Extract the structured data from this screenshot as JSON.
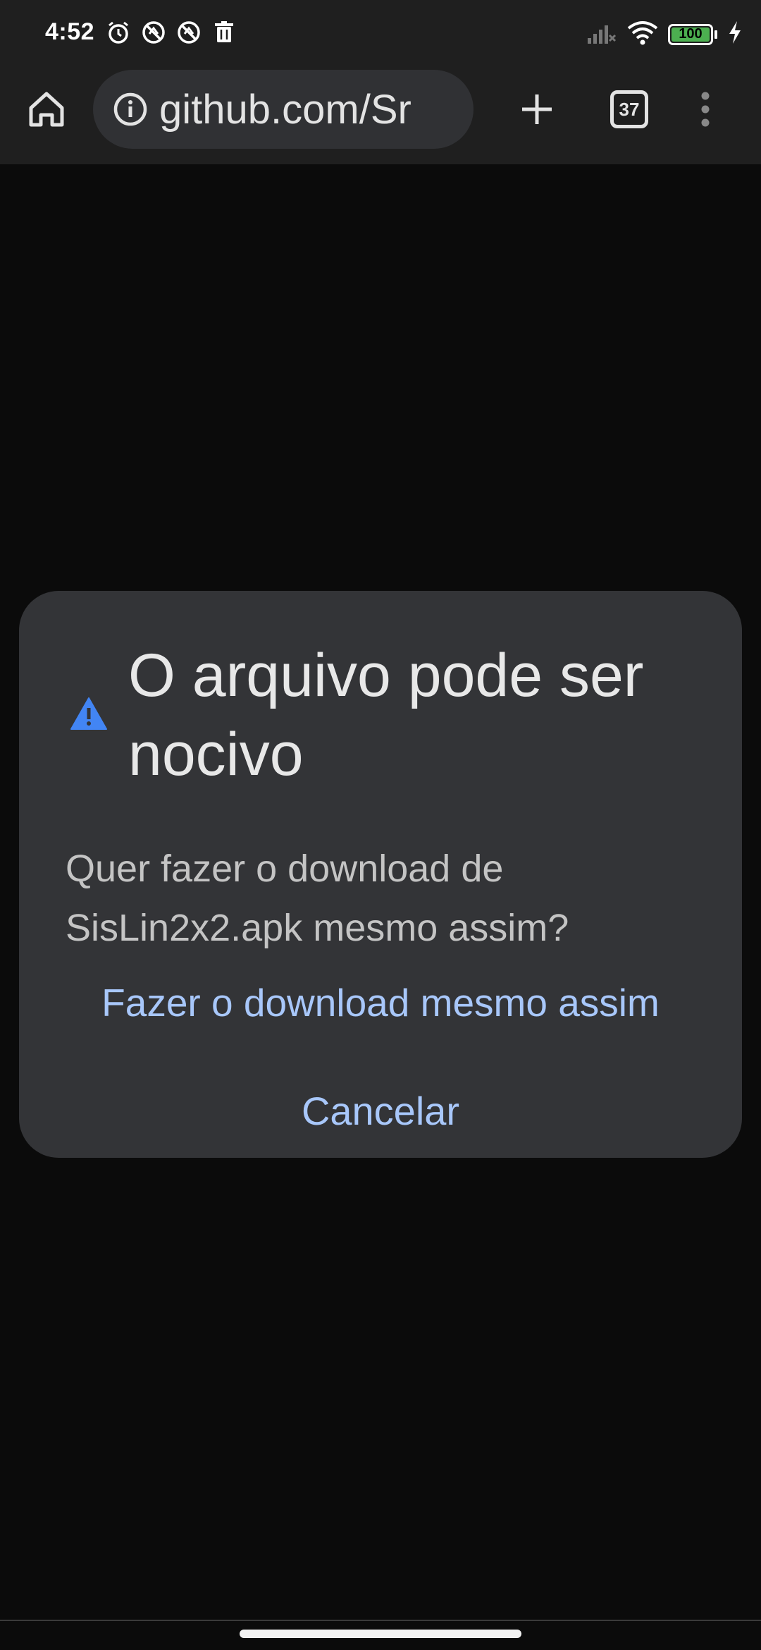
{
  "status_bar": {
    "time": "4:52",
    "notification_icons": [
      "alarm-icon",
      "no-disturb-icon",
      "no-disturb-icon",
      "trash-icon"
    ],
    "battery_level": "100",
    "system_icons": [
      "signal-icon",
      "wifi-icon",
      "battery-icon",
      "charging-icon"
    ]
  },
  "toolbar": {
    "url": "github.com/Sr",
    "tab_count": "37",
    "icons": [
      "home-icon",
      "info-icon",
      "plus-icon",
      "tabs-icon",
      "more-vert-icon"
    ]
  },
  "dialog": {
    "title": "O arquivo pode ser nocivo",
    "message": "Quer fazer o download de SisLin2x2.apk mesmo assim?",
    "download_label": "Fazer o download mesmo assim",
    "cancel_label": "Cancelar",
    "icon": "warning-icon"
  },
  "colors": {
    "background": "#0b0b0b",
    "toolbar": "#1f1f1f",
    "dialog": "#333437",
    "accent": "#a8c7fa",
    "warning": "#4285f4",
    "battery": "#4caf50"
  }
}
